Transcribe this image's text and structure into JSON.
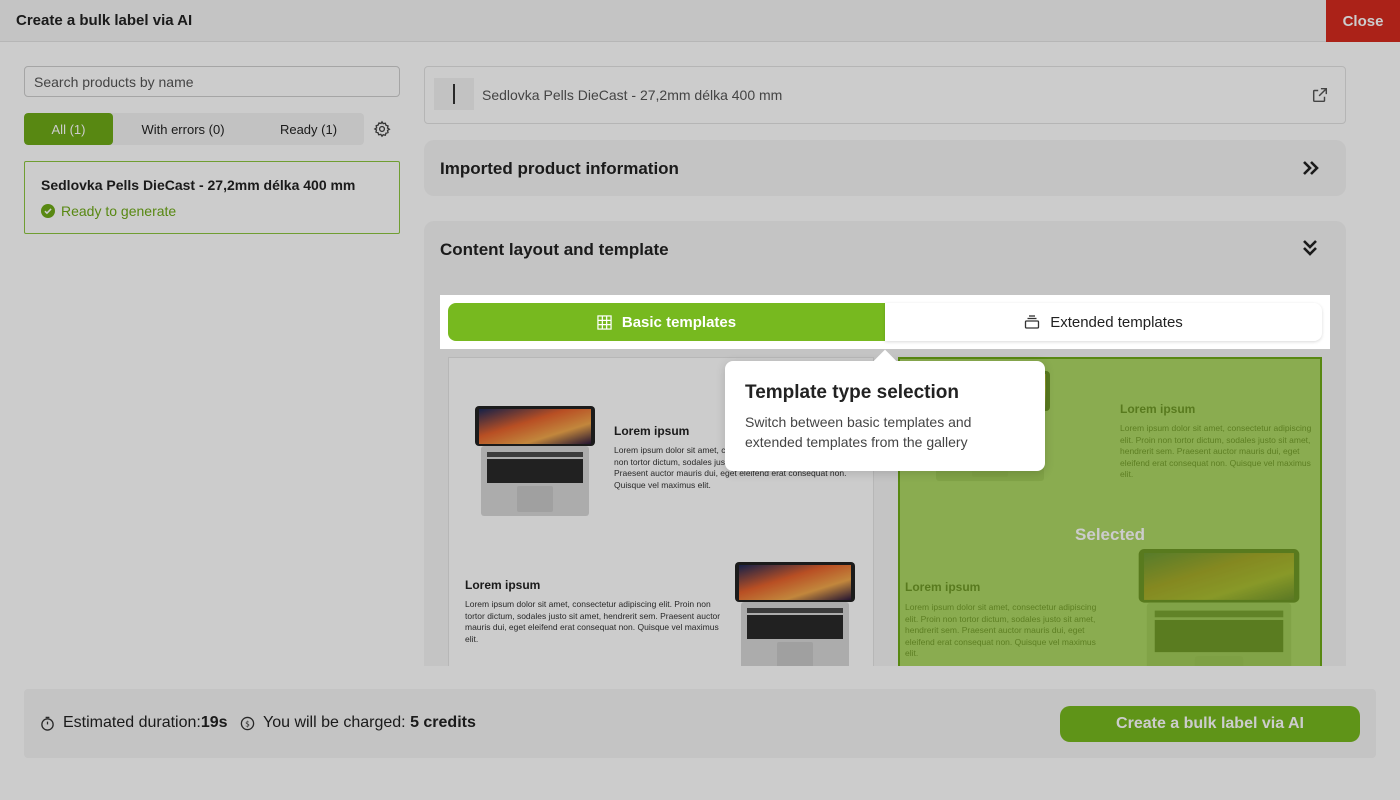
{
  "header": {
    "title": "Create a bulk label via AI",
    "close_label": "Close"
  },
  "sidebar": {
    "search_placeholder": "Search products by name",
    "filters": [
      {
        "label": "All (1)",
        "active": true
      },
      {
        "label": "With errors (0)",
        "active": false
      },
      {
        "label": "Ready (1)",
        "active": false
      }
    ],
    "products": [
      {
        "name": "Sedlovka Pells DieCast - 27,2mm délka 400 mm",
        "status": "Ready to generate"
      }
    ]
  },
  "main": {
    "product_name": "Sedlovka Pells DieCast - 27,2mm délka 400 mm",
    "sections": {
      "imported": "Imported product information",
      "layout": "Content layout and template"
    },
    "template_tabs": {
      "basic": "Basic templates",
      "extended": "Extended templates"
    },
    "template_cards": {
      "lorem_title": "Lorem ipsum",
      "lorem_body": "Lorem ipsum dolor sit amet, consectetur adipiscing elit. Proin non tortor dictum, sodales justo sit amet, hendrerit sem. Praesent auctor mauris dui, eget eleifend erat consequat non. Quisque vel maximus elit.",
      "selected_label": "Selected"
    }
  },
  "tooltip": {
    "title": "Template type selection",
    "text": "Switch between basic templates and extended templates from the gallery"
  },
  "footer": {
    "duration_label": "Estimated duration:",
    "duration_value": "19s",
    "charge_label": "You will be charged: ",
    "charge_value": "5 credits",
    "create_label": "Create a bulk label via AI"
  },
  "colors": {
    "accent": "#77b91f",
    "close": "#d62b1f"
  }
}
